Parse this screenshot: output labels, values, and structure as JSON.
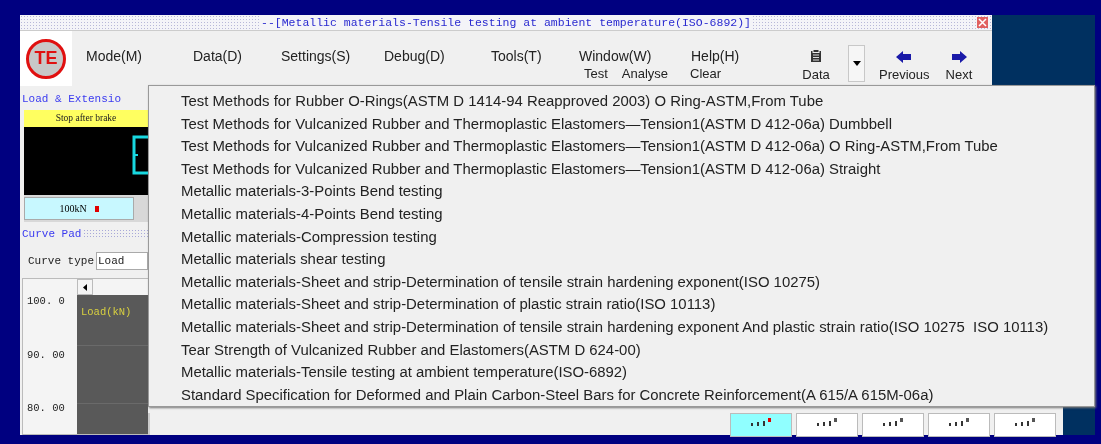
{
  "window": {
    "title": "--[Metallic materials-Tensile testing at ambient temperature(ISO-6892)]"
  },
  "logo": {
    "text": "TE"
  },
  "menu_bar": [
    {
      "label": "Mode(M)"
    },
    {
      "label": "Data(D)"
    },
    {
      "label": "Settings(S)"
    },
    {
      "label": "Debug(D)"
    },
    {
      "label": "Tools(T)"
    },
    {
      "label": "Window(W)"
    },
    {
      "label": "Help(H)"
    }
  ],
  "toolbar_text": [
    "Test",
    "Analyse",
    "Clear"
  ],
  "toolbar": {
    "data": "Data",
    "previous": "Previous",
    "next": "Next"
  },
  "load_panel": {
    "heading": "Load & Extensio",
    "status": "Stop after brake",
    "range": "100kN"
  },
  "curve_pad": {
    "heading": "Curve Pad",
    "curve_type_label": "Curve type",
    "curve_type_value": "Load",
    "y_ticks": [
      "100. 0",
      "90. 00",
      "80. 00"
    ],
    "series_label": "Load(kN)"
  },
  "dropdown": [
    {
      "label": "Test Methods for Rubber O-Rings(ASTM D 1414-94 Reapproved 2003) O Ring-ASTM,From Tube"
    },
    {
      "label": "Test Methods for Vulcanized Rubber and Thermoplastic Elastomers—Tension1(ASTM D 412-06a) Dumbbell"
    },
    {
      "label": "Test Methods for Vulcanized Rubber and Thermoplastic Elastomers—Tension1(ASTM D 412-06a) O Ring-ASTM,From Tube"
    },
    {
      "label": "Test Methods for Vulcanized Rubber and Thermoplastic Elastomers—Tension1(ASTM D 412-06a) Straight"
    },
    {
      "label": "Metallic materials-3-Points Bend testing"
    },
    {
      "label": "Metallic materials-4-Points Bend testing"
    },
    {
      "label": "Metallic materials-Compression testing"
    },
    {
      "label": "Metallic materials shear testing"
    },
    {
      "label": "Metallic materials-Sheet and strip-Determination of tensile strain hardening exponent(ISO 10275)"
    },
    {
      "label": "Metallic materials-Sheet and strip-Determination of plastic strain ratio(ISO 10113)"
    },
    {
      "label": "Metallic materials-Sheet and strip-Determination of tensile strain hardening exponent And plastic strain ratio(ISO 10275  ISO 10113)"
    },
    {
      "label": "Tear Strength of Vulcanized Rubber and Elastomers(ASTM D 624-00)"
    },
    {
      "label": "Metallic materials-Tensile testing at ambient temperature(ISO-6892)"
    },
    {
      "label": "Standard Specification for Deformed and Plain Carbon-Steel Bars for Concrete Reinforcement(A 615/A 615M-06a)"
    }
  ],
  "view_buttons": [
    {
      "selected": true
    },
    {
      "selected": false
    },
    {
      "selected": false
    },
    {
      "selected": false
    },
    {
      "selected": false
    }
  ]
}
